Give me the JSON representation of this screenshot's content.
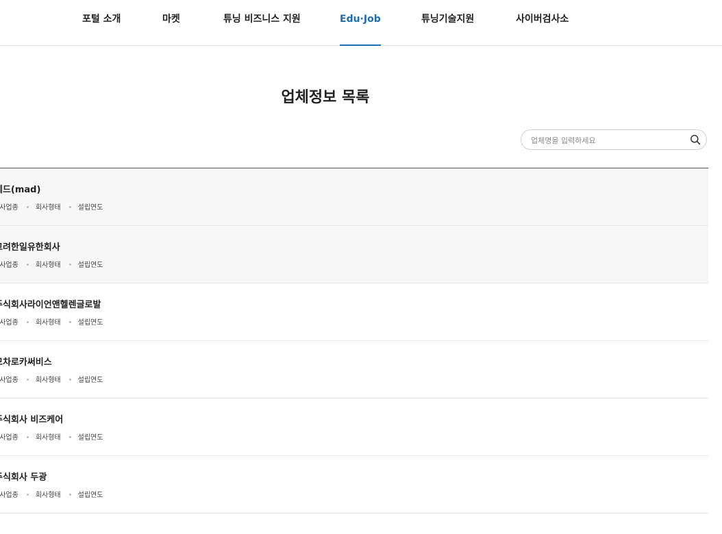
{
  "nav": {
    "items": [
      {
        "label": "포털 소개"
      },
      {
        "label": "마켓"
      },
      {
        "label": "튜닝 비즈니스 지원"
      },
      {
        "label": "Edu·Job"
      },
      {
        "label": "튜닝기술지원"
      },
      {
        "label": "사이버검사소"
      }
    ],
    "active": "Edu·Job"
  },
  "page": {
    "title": "업체정보 목록"
  },
  "search": {
    "placeholder": "업체명을 입력하세요"
  },
  "list": {
    "meta_labels": [
      "회사업종",
      "회사형태",
      "설립연도"
    ],
    "items": [
      {
        "name": "메드(mad)"
      },
      {
        "name": "고려한일유한회사"
      },
      {
        "name": "주식회사라이언앤헬렌글로발"
      },
      {
        "name": "모차로카써비스"
      },
      {
        "name": "주식회사 비즈케어"
      },
      {
        "name": "주식회사 두광"
      }
    ]
  },
  "colors": {
    "accent": "#1a6fb5",
    "row_highlight": "#f7f7f7"
  }
}
